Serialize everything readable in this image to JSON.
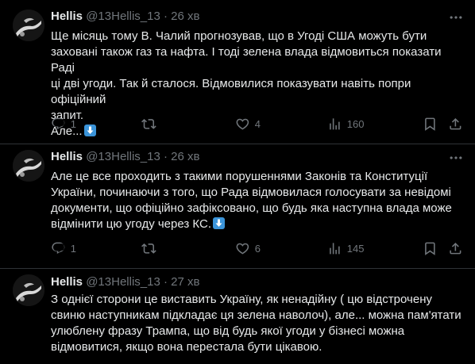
{
  "tweets": [
    {
      "name": "Hellis",
      "handle": "@13Hellis_13",
      "dot": "·",
      "time": "26 хв",
      "lines": [
        "Ще місяць тому В. Чалий прогнозував, що в Угоді США можуть бути",
        "заховані також газ та нафта. І тоді зелена влада відмовиться показати Раді",
        "ці дві угоди. Так й сталося. Відмовилися показувати навіть попри офіційний",
        "запит.",
        "Але..."
      ],
      "emoji": "down-arrow-emoji",
      "replies": "1",
      "retweets": "",
      "likes": "4",
      "views": "160"
    },
    {
      "name": "Hellis",
      "handle": "@13Hellis_13",
      "dot": "·",
      "time": "26 хв",
      "lines": [
        "Але це все проходить з такими порушеннями Законів та Конституції",
        "України, починаючи з того, що Рада відмовилася голосувати за невідомі",
        "документи, що офіційно зафіксовано,  що будь яка наступна влада може",
        "відмінити цю угоду через КС."
      ],
      "emoji": "down-arrow-emoji",
      "replies": "1",
      "retweets": "",
      "likes": "6",
      "views": "145"
    },
    {
      "name": "Hellis",
      "handle": "@13Hellis_13",
      "dot": "·",
      "time": "27 хв",
      "lines": [
        "З однієї сторони це виставить Україну, як ненадійну ( цю відстрочену",
        "свиню наступникам підкладає ця зелена наволоч), але... можна пам'ятати",
        "улюблену фразу Трампа, що від будь якої угоди у бізнесі можна",
        "відмовитися, якщо вона перестала бути цікавою."
      ]
    }
  ],
  "icons": {
    "reply": "reply-icon",
    "retweet": "retweet-icon",
    "like": "heart-icon",
    "views": "views-icon",
    "bookmark": "bookmark-icon",
    "share": "share-icon",
    "more": "more-icon"
  },
  "colors": {
    "background": "#000000",
    "text": "#e7e9ea",
    "muted": "#71767b",
    "separator": "#2f3336",
    "emoji": "#3b94d9"
  }
}
